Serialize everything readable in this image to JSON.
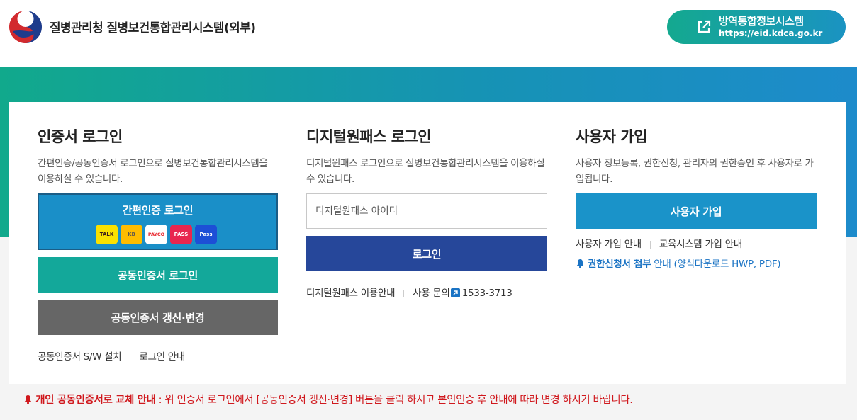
{
  "header": {
    "site_title": "질병관리청 질병보건통합관리시스템(외부)",
    "external_button": {
      "title": "방역통합정보시스템",
      "url": "https://eid.kdca.go.kr"
    }
  },
  "cert_login": {
    "title": "인증서 로그인",
    "description": "간편인증/공동인증서 로그인으로 질병보건통합관리시스템을 이용하실 수 있습니다.",
    "simple_auth_label": "간편인증 로그인",
    "auth_providers": [
      "TALK",
      "KB",
      "PAYCO",
      "PASS",
      "Pass"
    ],
    "cert_login_label": "공동인증서 로그인",
    "cert_renew_label": "공동인증서 갱신·변경",
    "links": {
      "sw_install": "공동인증서 S/W 설치",
      "login_guide": "로그인 안내"
    }
  },
  "digital_onepass": {
    "title": "디지털원패스 로그인",
    "description": "디지털원패스 로그인으로 질병보건통합관리시스템을 이용하실수 있습니다.",
    "id_placeholder": "디지털원패스 아이디",
    "login_label": "로그인",
    "links": {
      "usage_guide": "디지털원패스 이용안내",
      "inquiry_label": "사용 문의",
      "inquiry_phone": "1533-3713"
    }
  },
  "user_join": {
    "title": "사용자 가입",
    "description": "사용자 정보등록, 권한신청, 관리자의 권한승인 후 사용자로 가입됩니다.",
    "join_label": "사용자 가입",
    "links": {
      "join_guide": "사용자 가입 안내",
      "edu_join_guide": "교육시스템 가입 안내"
    },
    "notice_strong": "권한신청서 첨부",
    "notice_rest": "안내 (양식다운로드 HWP, PDF)"
  },
  "bottom_notice": {
    "strong": "개인 공동인증서로 교체 안내",
    "text": " : 위 인증서 로그인에서 [공동인증서 갱신·변경] 버튼을 클릭 하시고 본인인증 후 안내에 따라 변경 하시기 바랍니다."
  },
  "colors": {
    "simple_auth": "#1a8fc8",
    "cert_login": "#13a89a",
    "cert_renew": "#666666",
    "onepass_login": "#26479a",
    "join": "#1a93c9",
    "notice_red": "#d0181d",
    "notice_blue": "#1a73c4"
  }
}
